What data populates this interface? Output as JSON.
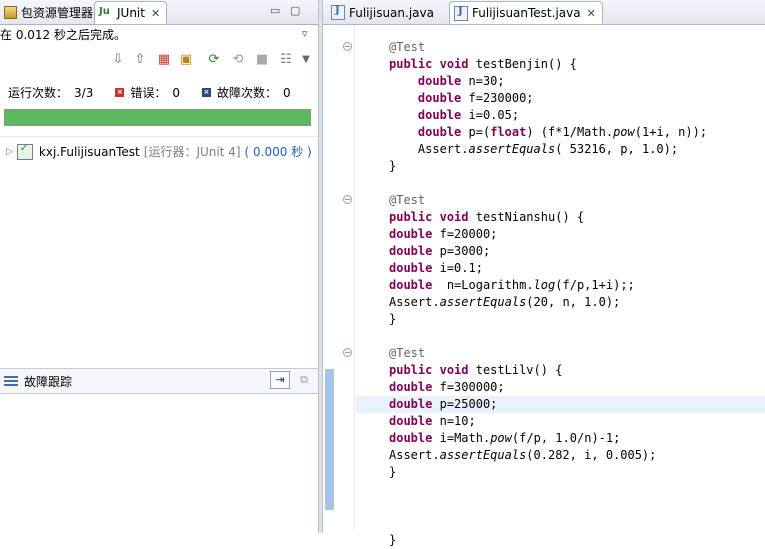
{
  "left_panel": {
    "tabs": [
      {
        "label": "包资源管理器"
      },
      {
        "label": "JUnit"
      }
    ],
    "status": "在 0.012 秒之后完成。",
    "counts": {
      "runs_label": "运行次数：",
      "runs_value": "3/3",
      "errors_label": "错误：",
      "errors_value": "0",
      "failures_label": "故障次数：",
      "failures_value": "0"
    },
    "progress": 1.0,
    "test_tree": {
      "suite_name": "kxj.FulijisuanTest",
      "runner": "[运行器：JUnit 4]",
      "time": "( 0.000 秒 )"
    },
    "failure_trace_title": "故障跟踪"
  },
  "editor": {
    "tabs": [
      {
        "label": "Fulijisuan.java"
      },
      {
        "label": "FulijisuanTest.java"
      }
    ],
    "code_lines": [
      "@Test",
      "public void testBenjin() {",
      "    double n=30;",
      "    double f=230000;",
      "    double i=0.05;",
      "    double p=(float) (f*1/Math.pow(1+i, n));",
      "    Assert.assertEquals( 53216, p, 1.0);",
      "}",
      "",
      "@Test",
      "public void testNianshu() {",
      "double f=20000;",
      "double p=3000;",
      "double i=0.1;",
      "double  n=Logarithm.log(f/p,1+i);;",
      "Assert.assertEquals(20, n, 1.0);",
      "}",
      "",
      "@Test",
      "public void testLilv() {",
      "double f=300000;",
      "double p=25000;",
      "double n=10;",
      "double i=Math.pow(f/p, 1.0/n)-1;",
      "Assert.assertEquals(0.282, i, 0.005);",
      "}",
      "",
      "",
      "",
      "}"
    ]
  },
  "colors": {
    "progress_green": "#5cb85c",
    "keyword": "#7f0055",
    "annotation": "#646464",
    "runner_gray": "#7d7d7d",
    "time_blue": "#1f5fbf"
  }
}
